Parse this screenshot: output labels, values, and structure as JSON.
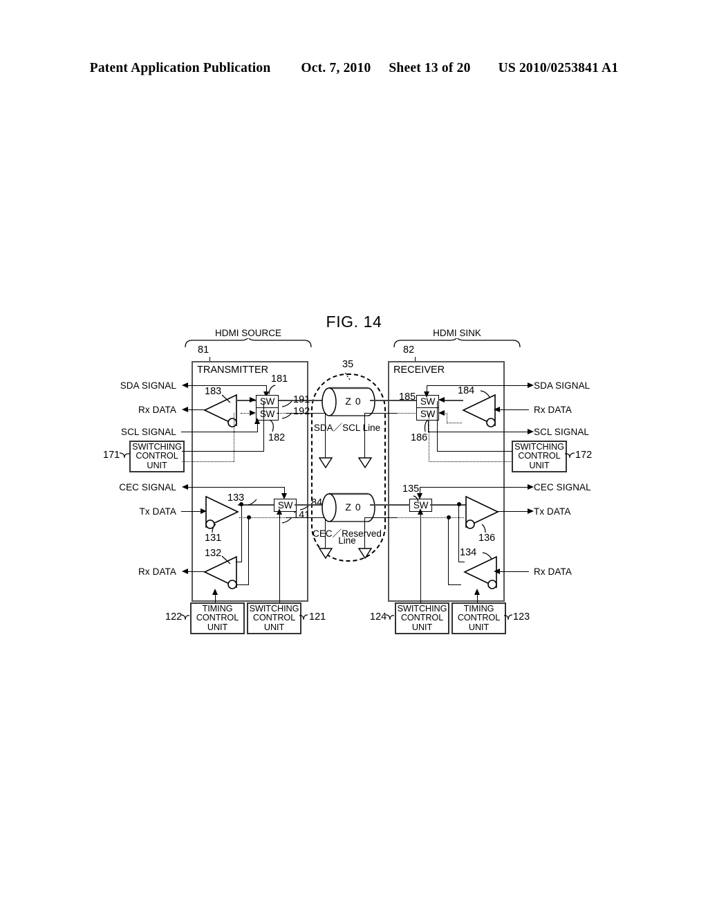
{
  "header": {
    "publication": "Patent Application Publication",
    "date": "Oct. 7, 2010",
    "sheet": "Sheet 13 of 20",
    "docnum": "US 2010/0253841 A1"
  },
  "figure": {
    "title": "FIG. 14",
    "groups": [
      {
        "name": "HDMI SOURCE",
        "ref": "81"
      },
      {
        "name": "HDMI SINK",
        "ref": "82"
      }
    ],
    "units": {
      "transmitter": {
        "caption": "TRANSMITTER",
        "ref": "81"
      },
      "receiver": {
        "caption": "RECEIVER",
        "ref": "82"
      }
    },
    "cable": {
      "ref": "35",
      "lines": [
        {
          "impedance": "Z 0",
          "label": "SDA／SCL Line"
        },
        {
          "impedance": "Z 0",
          "label": "CEC／Reserved\nLine"
        }
      ],
      "impedance_text": "Z 0",
      "sda_scl_label": "SDA／SCL Line",
      "cec_line_label_1": "CEC／Reserved",
      "cec_line_label_2": "Line"
    },
    "left_ports": [
      {
        "label": "SDA SIGNAL",
        "dir": "out"
      },
      {
        "label": "Rx DATA",
        "dir": "out"
      },
      {
        "label": "SCL SIGNAL",
        "dir": "in"
      },
      {
        "label": "CEC SIGNAL",
        "dir": "out"
      },
      {
        "label": "Tx DATA",
        "dir": "in"
      },
      {
        "label": "Rx DATA",
        "dir": "out"
      }
    ],
    "right_ports": [
      {
        "label": "SDA SIGNAL",
        "dir": "out"
      },
      {
        "label": "Rx DATA",
        "dir": "in"
      },
      {
        "label": "SCL SIGNAL",
        "dir": "out"
      },
      {
        "label": "CEC SIGNAL",
        "dir": "out"
      },
      {
        "label": "Tx DATA",
        "dir": "out"
      },
      {
        "label": "Rx DATA",
        "dir": "in"
      }
    ],
    "switch_label": "SW",
    "switches": [
      {
        "ref": "181",
        "side": "left"
      },
      {
        "ref": "182",
        "side": "left"
      },
      {
        "ref": "84",
        "side": "left"
      },
      {
        "ref": "185",
        "side": "right"
      },
      {
        "ref": "186",
        "side": "right"
      },
      {
        "ref": "135",
        "side": "right"
      }
    ],
    "buffers": [
      {
        "ref": "183",
        "side": "left"
      },
      {
        "ref": "131",
        "side": "left"
      },
      {
        "ref": "132",
        "side": "left"
      },
      {
        "ref": "184",
        "side": "right"
      },
      {
        "ref": "136",
        "side": "right"
      },
      {
        "ref": "134",
        "side": "right"
      }
    ],
    "signal_refs": [
      {
        "ref": "191"
      },
      {
        "ref": "192"
      },
      {
        "ref": "141"
      },
      {
        "ref": "133"
      }
    ],
    "control_units": [
      {
        "ref": "171",
        "line1": "SWITCHING",
        "line2": "CONTROL",
        "line3": "UNIT"
      },
      {
        "ref": "172",
        "line1": "SWITCHING",
        "line2": "CONTROL",
        "line3": "UNIT"
      },
      {
        "ref": "122",
        "line1": "TIMING",
        "line2": "CONTROL",
        "line3": "UNIT"
      },
      {
        "ref": "121",
        "line1": "SWITCHING",
        "line2": "CONTROL",
        "line3": "UNIT"
      },
      {
        "ref": "124",
        "line1": "SWITCHING",
        "line2": "CONTROL",
        "line3": "UNIT"
      },
      {
        "ref": "123",
        "line1": "TIMING",
        "line2": "CONTROL",
        "line3": "UNIT"
      }
    ],
    "text": {
      "switching": "SWITCHING",
      "timing": "TIMING",
      "control": "CONTROL",
      "unit": "UNIT"
    },
    "colors": {
      "ink": "#000000",
      "boxgray": "#555555",
      "paper": "#ffffff"
    }
  }
}
